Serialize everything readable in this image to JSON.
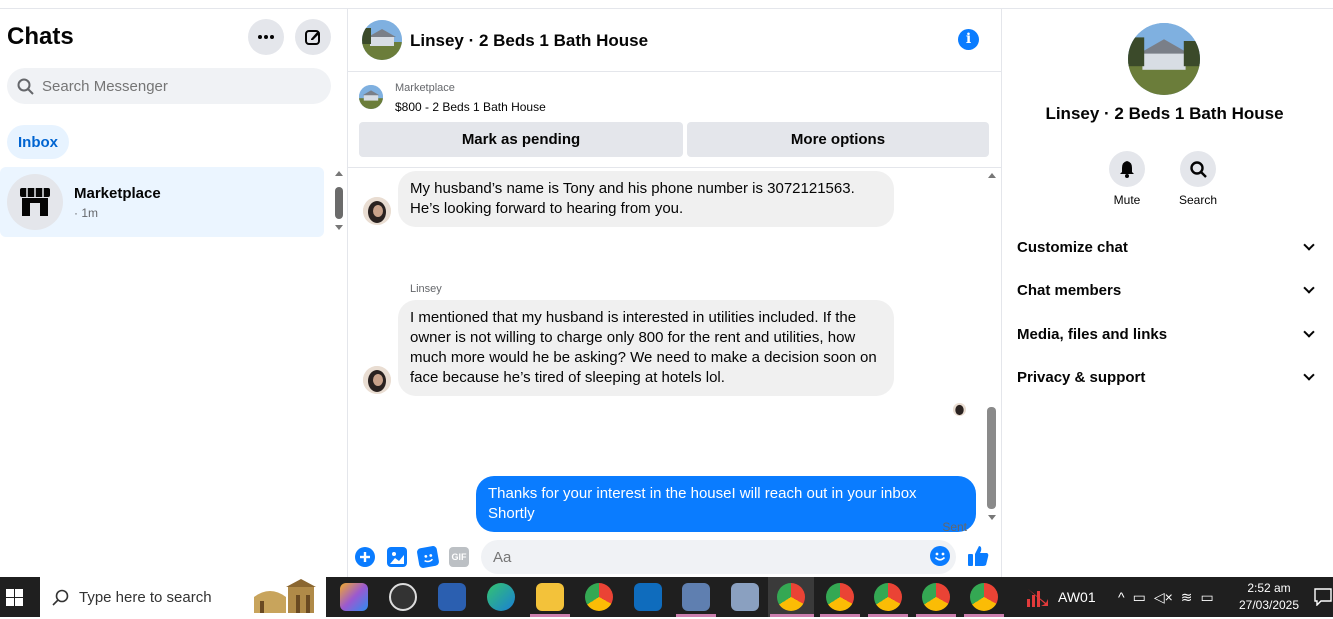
{
  "sidebar": {
    "title": "Chats",
    "search_placeholder": "Search Messenger",
    "inbox_label": "Inbox",
    "conversations": [
      {
        "name": "Marketplace",
        "time": "· 1m"
      }
    ]
  },
  "chat": {
    "title": "Linsey · 2 Beds 1 Bath House",
    "marketplace_label": "Marketplace",
    "listing": "$800 - 2 Beds 1 Bath House",
    "mark_pending_label": "Mark as pending",
    "more_options_label": "More options",
    "messages": [
      {
        "sender": "",
        "text": "My husband’s name is Tony and his phone number is 3072121563. He’s looking forward to hearing from you.",
        "outgoing": false
      },
      {
        "sender": "Linsey",
        "text": "I mentioned that my husband is interested in utilities included. If the owner is not willing to charge only 800 for the rent and utilities, how much more would he be asking? We need to make a decision soon on face because he’s tired of sleeping at hotels lol.",
        "outgoing": false
      },
      {
        "sender": "",
        "text": "Thanks for your interest in the houseI will reach out in your inbox Shortly",
        "outgoing": true
      }
    ],
    "sent_status": "Sent",
    "composer_placeholder": "Aa",
    "gif_label": "GIF"
  },
  "details": {
    "name": "Linsey · 2 Beds 1 Bath House",
    "mute_label": "Mute",
    "search_label": "Search",
    "sections": [
      "Customize chat",
      "Chat members",
      "Media, files and links",
      "Privacy & support"
    ]
  },
  "taskbar": {
    "search_placeholder": "Type here to search",
    "tray_app": "AW01",
    "time": "2:52 am",
    "date": "27/03/2025"
  },
  "colors": {
    "accent": "#0a7cff",
    "selected_bg": "#ebf5ff",
    "bubble_in": "#f0f0f0",
    "taskbar": "#1f1f1f"
  }
}
